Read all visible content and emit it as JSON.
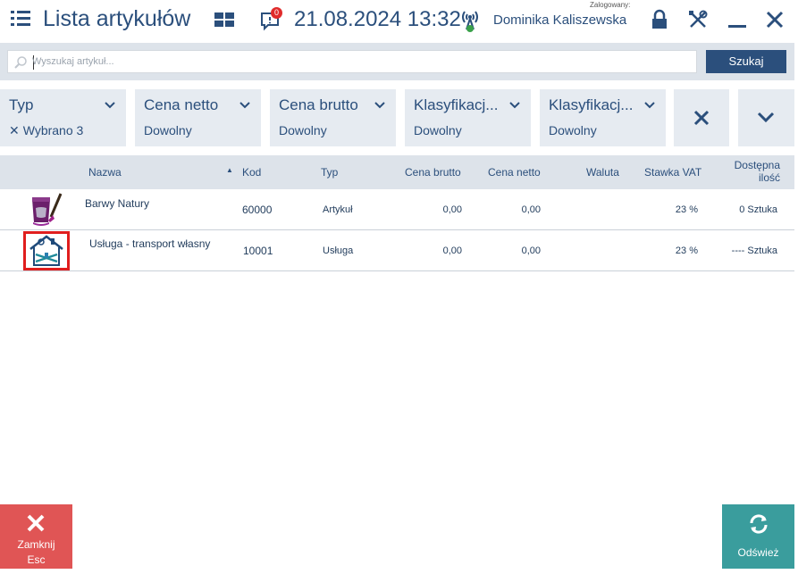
{
  "header": {
    "title": "Lista artykułów",
    "notification_count": "0",
    "datetime": "21.08.2024 13:32",
    "logged_label": "Zalogowany:",
    "user_name": "Dominika Kaliszewska"
  },
  "search": {
    "placeholder": "Wyszukaj artykuł...",
    "button_label": "Szukaj"
  },
  "filters": [
    {
      "title": "Typ",
      "value": "Wybrano 3",
      "has_clear": true
    },
    {
      "title": "Cena netto",
      "value": "Dowolny",
      "has_clear": false
    },
    {
      "title": "Cena brutto",
      "value": "Dowolny",
      "has_clear": false
    },
    {
      "title": "Klasyfikacj...",
      "value": "Dowolny",
      "has_clear": false
    },
    {
      "title": "Klasyfikacj...",
      "value": "Dowolny",
      "has_clear": false
    }
  ],
  "table": {
    "columns": {
      "name": "Nazwa",
      "sort_indicator": "▲",
      "code": "Kod",
      "type": "Typ",
      "gross": "Cena brutto",
      "net": "Cena netto",
      "currency": "Waluta",
      "vat": "Stawka VAT",
      "available_1": "Dostępna",
      "available_2": "ilość"
    },
    "rows": [
      {
        "name": "Barwy Natury",
        "code": "60000",
        "type": "Artykuł",
        "gross": "0,00",
        "net": "0,00",
        "currency": "",
        "vat": "23 %",
        "available": "0 Sztuka",
        "icon": "paint-bucket-icon"
      },
      {
        "name": "Usługa - transport własny",
        "code": "10001",
        "type": "Usługa",
        "gross": "0,00",
        "net": "0,00",
        "currency": "",
        "vat": "23 %",
        "available": "---- Sztuka",
        "icon": "house-service-icon"
      }
    ]
  },
  "footer": {
    "close_label": "Zamknij",
    "close_shortcut": "Esc",
    "refresh_label": "Odśwież"
  },
  "colors": {
    "primary": "#2b4f7c",
    "close": "#e05555",
    "refresh": "#3a9d9d",
    "selection": "#e01e1e"
  }
}
